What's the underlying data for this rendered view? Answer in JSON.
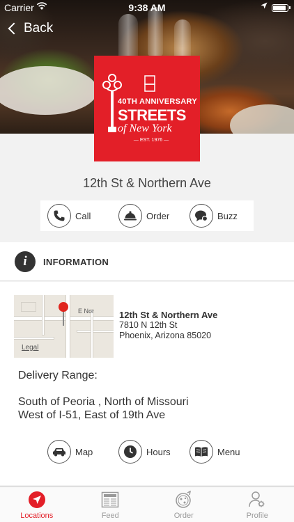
{
  "status_bar": {
    "carrier": "Carrier",
    "time": "9:38 AM"
  },
  "nav": {
    "back_label": "Back"
  },
  "logo": {
    "anniversary": "40TH ANNIVERSARY",
    "brand": "STREETS",
    "city": "of New York",
    "established": "— EST. 1976 —"
  },
  "location": {
    "title": "12th St & Northern Ave"
  },
  "actions_top": [
    {
      "label": "Call",
      "icon": "phone-icon"
    },
    {
      "label": "Order",
      "icon": "cloche-icon"
    },
    {
      "label": "Buzz",
      "icon": "chat-bubble-icon"
    }
  ],
  "info": {
    "section_label": "INFORMATION",
    "map": {
      "legal": "Legal",
      "street_label": "E Nor"
    },
    "address": {
      "name": "12th St & Northern Ave",
      "line1": "7810 N 12th St",
      "line2": "Phoenix, Arizona 85020"
    },
    "delivery_title": "Delivery Range:",
    "delivery_line1": "South of Peoria , North of Missouri",
    "delivery_line2": "West of I-51, East of 19th Ave"
  },
  "actions_bottom": [
    {
      "label": "Map",
      "icon": "car-icon"
    },
    {
      "label": "Hours",
      "icon": "clock-icon"
    },
    {
      "label": "Menu",
      "icon": "book-icon"
    }
  ],
  "tabbar": [
    {
      "label": "Locations",
      "icon": "navigation-arrow-icon",
      "active": true
    },
    {
      "label": "Feed",
      "icon": "newspaper-icon",
      "active": false
    },
    {
      "label": "Order",
      "icon": "pizza-icon",
      "active": false
    },
    {
      "label": "Profile",
      "icon": "user-gear-icon",
      "active": false
    }
  ],
  "colors": {
    "accent": "#e31f28",
    "tab_inactive": "#999999",
    "text": "#333333"
  }
}
